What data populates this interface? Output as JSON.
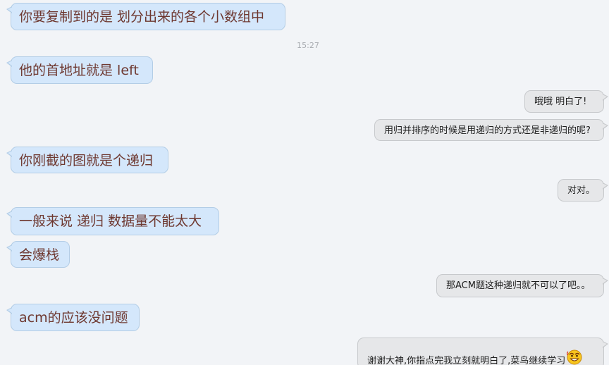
{
  "timestamp": "15:27",
  "messages": [
    {
      "side": "in",
      "text": "你要复制到的是 划分出来的各个小数组中"
    },
    {
      "side": "in",
      "text": "他的首地址就是 left"
    },
    {
      "side": "out",
      "text": "哦哦 明白了!"
    },
    {
      "side": "out",
      "text": "用归并排序的时候是用递归的方式还是非递归的呢?"
    },
    {
      "side": "in",
      "text": "你刚截的图就是个递归"
    },
    {
      "side": "out",
      "text": "对对。"
    },
    {
      "side": "in",
      "text": "一般来说 递归 数据量不能太大"
    },
    {
      "side": "in",
      "text": "会爆栈"
    },
    {
      "side": "out",
      "text": "那ACM题这种递归就不可以了吧。。"
    },
    {
      "side": "in",
      "text": "acm的应该没问题"
    },
    {
      "side": "out",
      "text": "谢谢大神,你指点完我立刻就明白了,菜鸟继续学习",
      "emoji": "grinning-face-emoji"
    }
  ],
  "colors": {
    "background": "#f2f4f7",
    "incoming_bubble": "#d4e7fb",
    "incoming_text": "#6e3830",
    "outgoing_bubble": "#e6e7e9",
    "outgoing_text": "#1e1e1e",
    "timestamp_text": "#a8abb0"
  }
}
